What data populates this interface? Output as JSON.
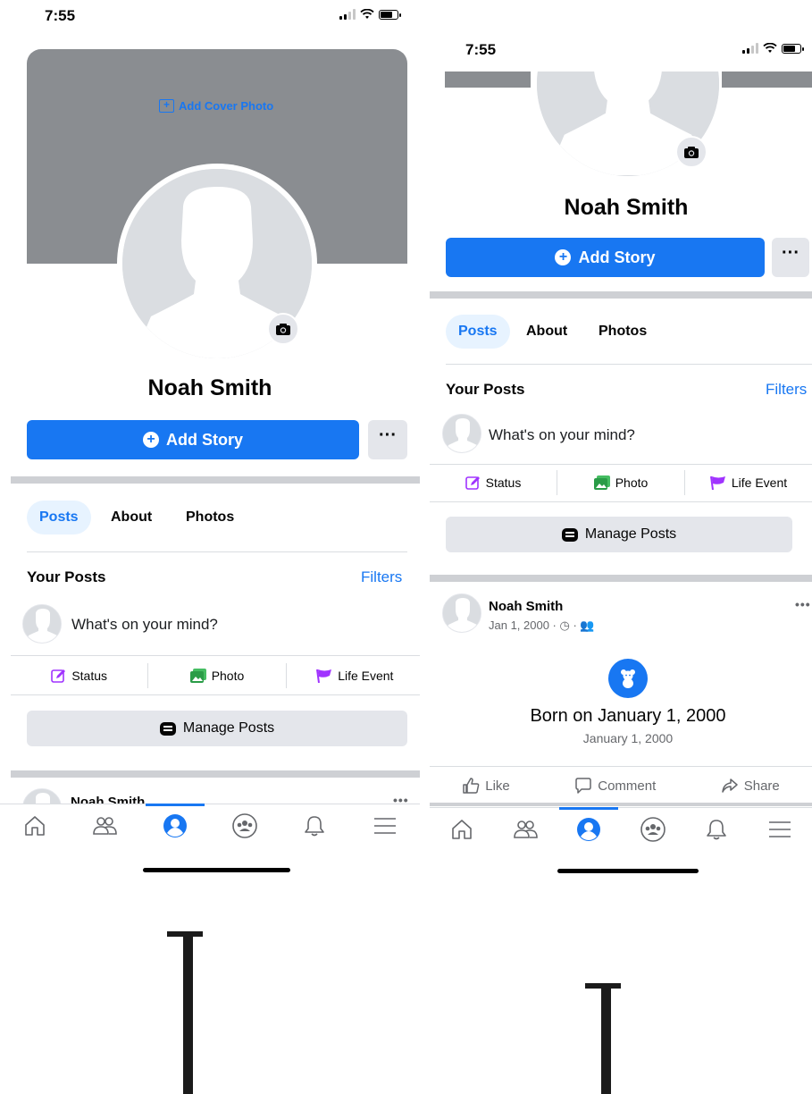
{
  "left": {
    "status": {
      "time": "7:55"
    },
    "cover": {
      "add_cover_label": "Add Cover Photo"
    },
    "profile": {
      "name": "Noah Smith"
    },
    "add_story_label": "Add Story",
    "more_label": "···",
    "tabs": [
      {
        "label": "Posts",
        "active": true
      },
      {
        "label": "About"
      },
      {
        "label": "Photos"
      }
    ],
    "your_posts": "Your Posts",
    "filters": "Filters",
    "composer_placeholder": "What's on your mind?",
    "actions": [
      {
        "label": "Status",
        "icon": "edit-icon"
      },
      {
        "label": "Photo",
        "icon": "photo-icon"
      },
      {
        "label": "Life Event",
        "icon": "flag-icon"
      }
    ],
    "manage_posts": "Manage Posts",
    "post_preview_name": "Noah Smith",
    "post_dots": "•••"
  },
  "right": {
    "status": {
      "time": "7:55"
    },
    "profile": {
      "name": "Noah Smith"
    },
    "add_story_label": "Add Story",
    "more_label": "···",
    "tabs": [
      {
        "label": "Posts",
        "active": true
      },
      {
        "label": "About"
      },
      {
        "label": "Photos"
      }
    ],
    "your_posts": "Your Posts",
    "filters": "Filters",
    "composer_placeholder": "What's on your mind?",
    "actions": [
      {
        "label": "Status",
        "icon": "edit-icon"
      },
      {
        "label": "Photo",
        "icon": "photo-icon"
      },
      {
        "label": "Life Event",
        "icon": "flag-icon"
      }
    ],
    "manage_posts": "Manage Posts",
    "post": {
      "author": "Noah Smith",
      "meta": "Jan 1, 2000 · ◷ · 👥",
      "dots": "•••",
      "event_title": "Born on January 1, 2000",
      "event_date": "January 1, 2000",
      "reactions": [
        {
          "label": "Like",
          "icon": "like-icon"
        },
        {
          "label": "Comment",
          "icon": "comment-icon"
        },
        {
          "label": "Share",
          "icon": "share-icon"
        }
      ]
    }
  },
  "colors": {
    "brand_blue": "#1877f2",
    "cover_gray": "#8a8d91",
    "divider_gray": "#ced0d4",
    "button_gray": "#e4e6eb"
  },
  "nav_icons": [
    "home-icon",
    "friends-icon",
    "profile-icon",
    "groups-icon",
    "bell-icon",
    "menu-icon"
  ]
}
